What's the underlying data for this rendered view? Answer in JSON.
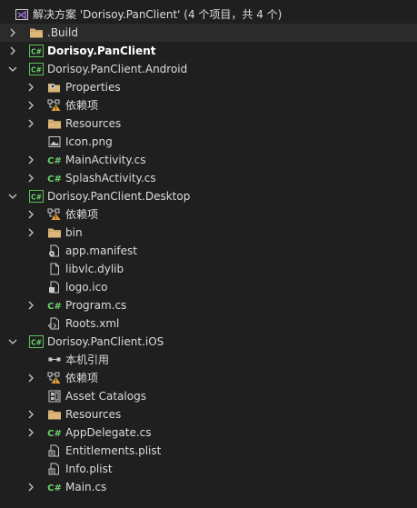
{
  "colors": {
    "background": "#1f1f1f",
    "text": "#dcdcdc",
    "folder": "#dcb67a",
    "csharp_green": "#6ed16b",
    "project_border": "#5fbf5a",
    "vs_purple": "#a06ee0",
    "warning": "#e8a33a"
  },
  "tree": [
    {
      "label": "解决方案 'Dorisoy.PanClient' (4 个项目，共 4 个)",
      "icon": "solution-icon",
      "depth": 0,
      "expander": "none"
    },
    {
      "label": ".Build",
      "icon": "folder-icon",
      "depth": 0,
      "expander": "collapsed",
      "selected": true
    },
    {
      "label": "Dorisoy.PanClient",
      "icon": "csharp-project-icon",
      "depth": 0,
      "expander": "collapsed",
      "bold": true
    },
    {
      "label": "Dorisoy.PanClient.Android",
      "icon": "csharp-project-icon",
      "depth": 0,
      "expander": "expanded"
    },
    {
      "label": "Properties",
      "icon": "properties-icon",
      "depth": 1,
      "expander": "collapsed"
    },
    {
      "label": "依赖项",
      "icon": "dependencies-warning-icon",
      "depth": 1,
      "expander": "collapsed"
    },
    {
      "label": "Resources",
      "icon": "folder-icon",
      "depth": 1,
      "expander": "collapsed"
    },
    {
      "label": "Icon.png",
      "icon": "image-file-icon",
      "depth": 1,
      "expander": "none"
    },
    {
      "label": "MainActivity.cs",
      "icon": "csharp-file-icon",
      "depth": 1,
      "expander": "collapsed"
    },
    {
      "label": "SplashActivity.cs",
      "icon": "csharp-file-icon",
      "depth": 1,
      "expander": "collapsed"
    },
    {
      "label": "Dorisoy.PanClient.Desktop",
      "icon": "csharp-project-icon",
      "depth": 0,
      "expander": "expanded"
    },
    {
      "label": "依赖项",
      "icon": "dependencies-warning-icon",
      "depth": 1,
      "expander": "collapsed"
    },
    {
      "label": "bin",
      "icon": "folder-icon",
      "depth": 1,
      "expander": "collapsed"
    },
    {
      "label": "app.manifest",
      "icon": "manifest-file-icon",
      "depth": 1,
      "expander": "none"
    },
    {
      "label": "libvlc.dylib",
      "icon": "blank-file-icon",
      "depth": 1,
      "expander": "none"
    },
    {
      "label": "logo.ico",
      "icon": "ico-file-icon",
      "depth": 1,
      "expander": "none"
    },
    {
      "label": "Program.cs",
      "icon": "csharp-file-icon",
      "depth": 1,
      "expander": "collapsed"
    },
    {
      "label": "Roots.xml",
      "icon": "xml-file-icon",
      "depth": 1,
      "expander": "none"
    },
    {
      "label": "Dorisoy.PanClient.iOS",
      "icon": "csharp-project-icon",
      "depth": 0,
      "expander": "expanded"
    },
    {
      "label": "本机引用",
      "icon": "native-references-icon",
      "depth": 1,
      "expander": "none"
    },
    {
      "label": "依赖项",
      "icon": "dependencies-warning-icon",
      "depth": 1,
      "expander": "collapsed"
    },
    {
      "label": "Asset Catalogs",
      "icon": "asset-catalog-icon",
      "depth": 1,
      "expander": "none"
    },
    {
      "label": "Resources",
      "icon": "folder-icon",
      "depth": 1,
      "expander": "collapsed"
    },
    {
      "label": "AppDelegate.cs",
      "icon": "csharp-file-icon",
      "depth": 1,
      "expander": "collapsed"
    },
    {
      "label": "Entitlements.plist",
      "icon": "plist-file-icon",
      "depth": 1,
      "expander": "none"
    },
    {
      "label": "Info.plist",
      "icon": "plist-file-icon",
      "depth": 1,
      "expander": "none"
    },
    {
      "label": "Main.cs",
      "icon": "csharp-file-icon",
      "depth": 1,
      "expander": "collapsed"
    }
  ]
}
